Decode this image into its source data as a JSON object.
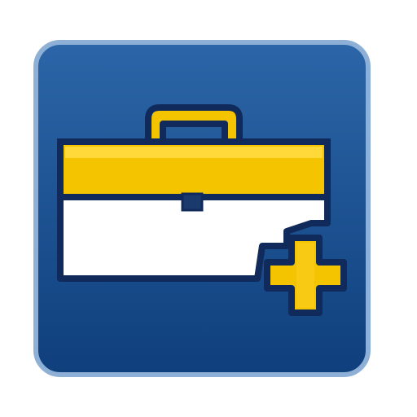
{
  "icon": {
    "name": "add-toolbox-icon",
    "glyphs": [
      "toolbox-icon",
      "plus-icon"
    ],
    "colors": {
      "tile_top": "#2c66a8",
      "tile_bottom": "#0f3f7c",
      "tile_edge": "#8fb0d6",
      "outline": "#112a5c",
      "lid": "#f5c400",
      "lid_highlight": "#ffd83a",
      "body": "#ffffff",
      "plus": "#f5c400"
    }
  }
}
